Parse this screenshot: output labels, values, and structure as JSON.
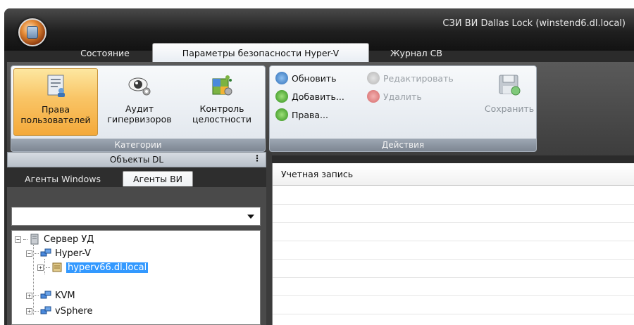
{
  "window": {
    "title": "СЗИ ВИ Dallas Lock (winstend6.dl.local)"
  },
  "tabs": [
    {
      "label": "Состояние"
    },
    {
      "label": "Параметры безопасности Hyper-V"
    },
    {
      "label": "Журнал СВ"
    }
  ],
  "ribbon": {
    "categories": {
      "label": "Категории",
      "buttons": [
        {
          "line1": "Права",
          "line2": "пользователей",
          "icon": "users-rights-icon"
        },
        {
          "line1": "Аудит",
          "line2": "гипервизоров",
          "icon": "eye-icon"
        },
        {
          "line1": "Контроль",
          "line2": "целостности",
          "icon": "integrity-icon"
        }
      ]
    },
    "actions": {
      "label": "Действия",
      "refresh": "Обновить",
      "add": "Добавить...",
      "rights": "Права...",
      "edit": "Редактировать",
      "delete": "Удалить",
      "save": "Сохранить"
    }
  },
  "left_panel": {
    "header": "Объекты DL",
    "grip": "⋮",
    "tabs": [
      {
        "label": "Агенты Windows"
      },
      {
        "label": "Агенты ВИ"
      }
    ],
    "dropdown_value": "",
    "tree": [
      {
        "label": "Сервер УД",
        "expander": "−"
      },
      {
        "label": "Hyper-V",
        "expander": "−"
      },
      {
        "label": "hyperv66.dl.local",
        "expander": "+"
      },
      {
        "label": "KVM",
        "expander": "+"
      },
      {
        "label": "vSphere",
        "expander": "+"
      }
    ]
  },
  "grid": {
    "columns": [
      "Учетная запись"
    ]
  },
  "colors": {
    "selected_node": "#3399ff",
    "selected_category": "#f9c465"
  }
}
